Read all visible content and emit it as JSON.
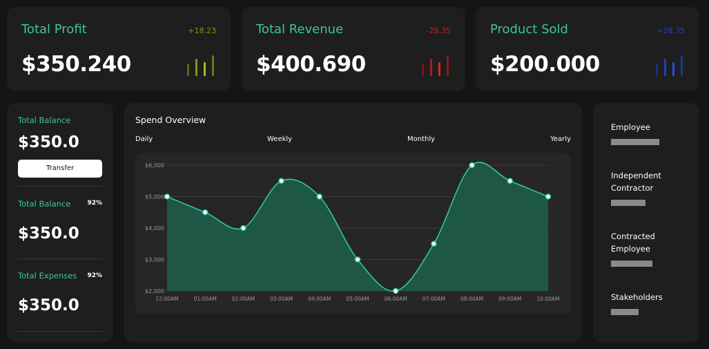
{
  "stats": [
    {
      "title": "Total Profit",
      "change": "+18.23",
      "value": "$350.240",
      "color": "#7a9a1c",
      "icon": "bar-chart-icon"
    },
    {
      "title": "Total Revenue",
      "change": "-28.35",
      "value": "$400.690",
      "color": "#c42323",
      "icon": "bar-chart-icon"
    },
    {
      "title": "Product Sold",
      "change": "+28.35",
      "value": "$200.000",
      "color": "#1f3fbf",
      "icon": "bar-chart-icon"
    }
  ],
  "balance": {
    "label1": "Total Balance",
    "value1": "$350.0",
    "transfer": "Transfer",
    "label2": "Total Balance",
    "pct2": "92%",
    "value2": "$350.0",
    "label3": "Total Expenses",
    "pct3": "92%",
    "value3": "$350.0"
  },
  "spend": {
    "title": "Spend Overview",
    "periods": [
      "Daily",
      "Weekly",
      "Monthly",
      "Yearly"
    ]
  },
  "chart_data": {
    "type": "area",
    "title": "",
    "xlabel": "",
    "ylabel": "",
    "x": [
      "12:00AM",
      "01:00AM",
      "02:00AM",
      "03:00AM",
      "04:00AM",
      "05:00AM",
      "06:00AM",
      "07:00AM",
      "08:00AM",
      "09:00AM",
      "10:00AM"
    ],
    "y_ticks": [
      "$2,000",
      "$3,000",
      "$4,000",
      "$5,000",
      "$6,000"
    ],
    "ylim": [
      2000,
      6000
    ],
    "series": [
      {
        "values": [
          5000,
          4500,
          4000,
          5500,
          5000,
          3000,
          2000,
          3500,
          6000,
          5500,
          5000
        ]
      }
    ],
    "color": "#2ec9a0",
    "grid": true
  },
  "legend": {
    "items": [
      {
        "label": "Employee"
      },
      {
        "label": "Independent Contractor"
      },
      {
        "label": "Contracted Employee"
      },
      {
        "label": "Stakeholders"
      }
    ]
  }
}
